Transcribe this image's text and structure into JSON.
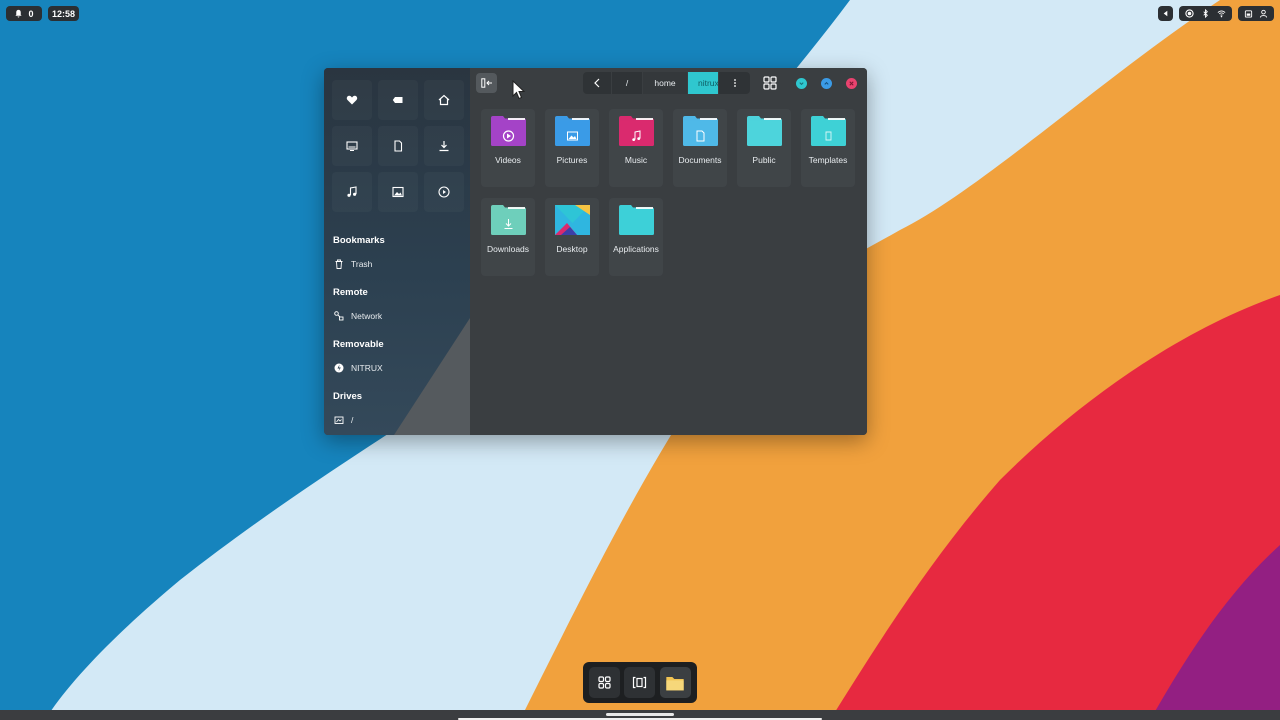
{
  "topbar": {
    "notifications_count": "0",
    "clock": "12:58"
  },
  "window": {
    "sidebar": {
      "quick_places": [
        {
          "icon": "heart-icon"
        },
        {
          "icon": "tag-icon"
        },
        {
          "icon": "home-icon"
        },
        {
          "icon": "desktop-icon"
        },
        {
          "icon": "document-icon"
        },
        {
          "icon": "download-icon"
        },
        {
          "icon": "music-note-icon"
        },
        {
          "icon": "image-icon"
        },
        {
          "icon": "play-icon"
        }
      ],
      "sections": {
        "bookmarks": "Bookmarks",
        "remote": "Remote",
        "removable": "Removable",
        "drives": "Drives"
      },
      "items": {
        "trash": "Trash",
        "network": "Network",
        "nitrux": "NITRUX",
        "root_drive": "/"
      }
    },
    "toolbar": {
      "path_root": "/",
      "path_home": "home",
      "path_current": "nitrux"
    },
    "folders": [
      {
        "label": "Videos",
        "color": "#a443c7"
      },
      {
        "label": "Pictures",
        "color": "#3b9be6"
      },
      {
        "label": "Music",
        "color": "#d92a6e"
      },
      {
        "label": "Documents",
        "color": "#4fb8e8"
      },
      {
        "label": "Public",
        "color": "#4dd3dc"
      },
      {
        "label": "Templates",
        "color": "#3ed1d6"
      },
      {
        "label": "Downloads",
        "color": "#6fcfbb"
      },
      {
        "label": "Desktop",
        "color": "#2fb6e0"
      },
      {
        "label": "Applications",
        "color": "#3dd0d8"
      }
    ]
  },
  "colors": {
    "accent": "#2fc7cf",
    "close": "#e9436f"
  }
}
